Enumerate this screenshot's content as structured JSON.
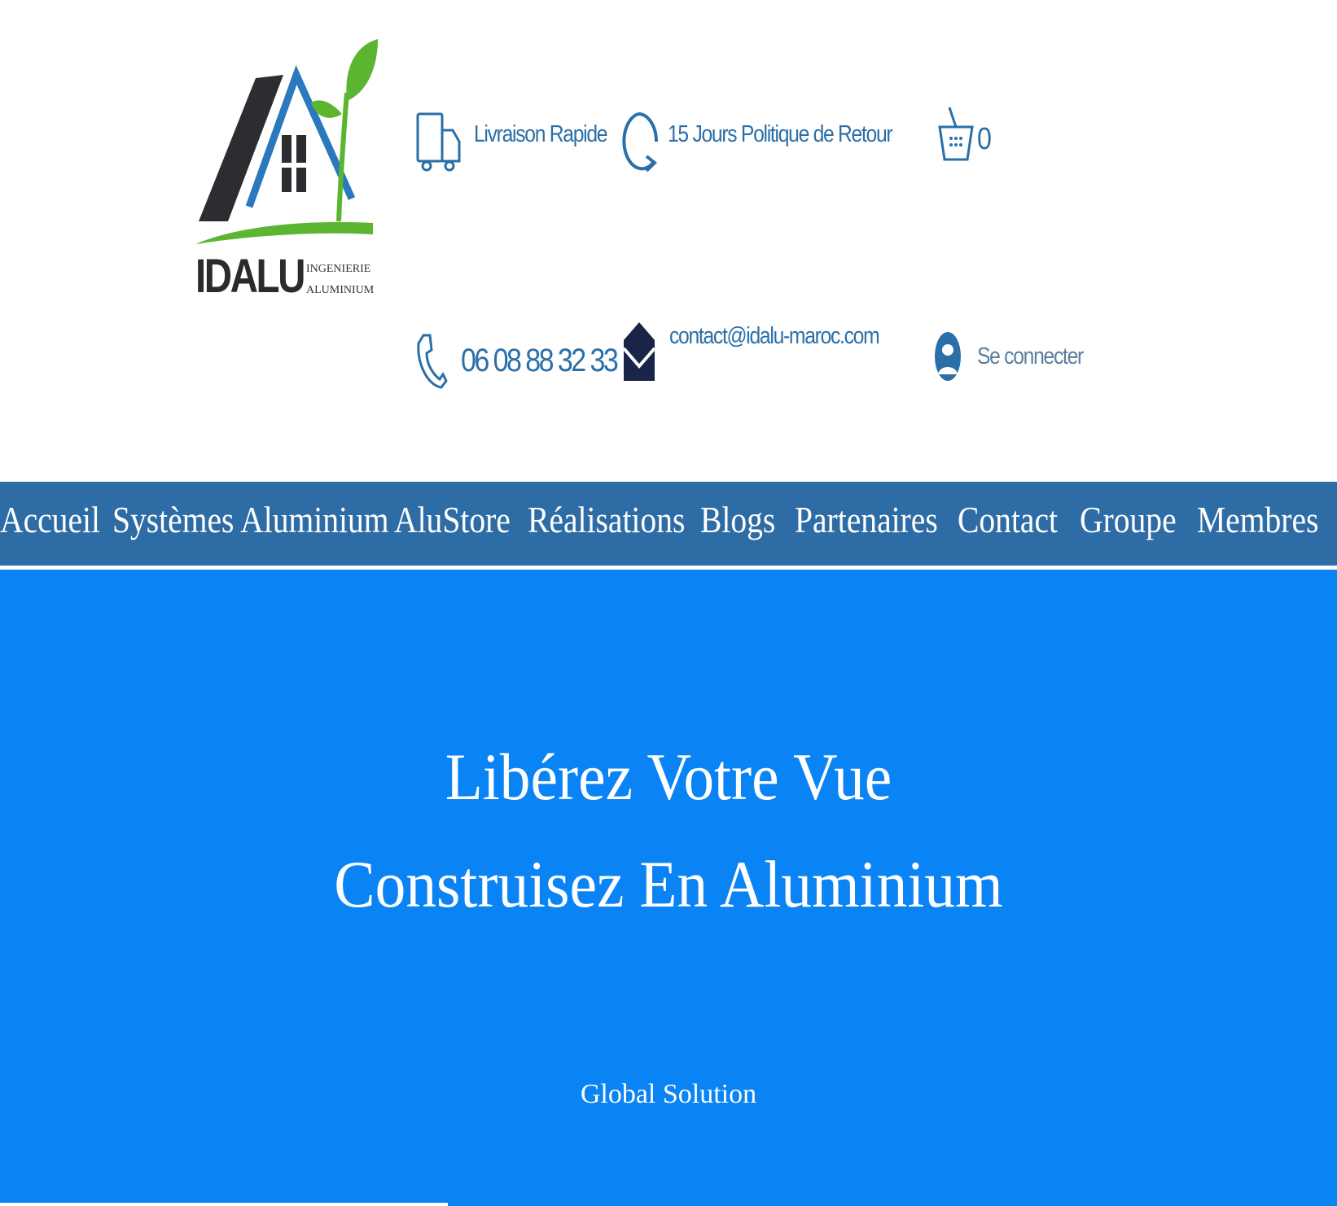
{
  "header": {
    "logo": {
      "name": "IDALU",
      "tagline_1": "INGENIERIE",
      "tagline_2": "ALUMINIUM"
    },
    "delivery": {
      "icon": "truck-icon",
      "label": "Livraison Rapide"
    },
    "returns": {
      "icon": "refresh-icon",
      "label": "15 Jours Politique de Retour"
    },
    "cart": {
      "icon": "basket-icon",
      "count": "0"
    },
    "phone": {
      "icon": "phone-icon",
      "label": "06 08 88 32 33"
    },
    "email": {
      "icon": "envelope-icon",
      "label": "contact@idalu-maroc.com"
    },
    "login": {
      "icon": "user-icon",
      "label": "Se connecter"
    }
  },
  "nav": {
    "items": [
      {
        "label": "Accueil"
      },
      {
        "label": "Systèmes Aluminium"
      },
      {
        "label": "AluStore"
      },
      {
        "label": "Réalisations"
      },
      {
        "label": "Blogs"
      },
      {
        "label": "Partenaires"
      },
      {
        "label": "Contact"
      },
      {
        "label": "Groupe"
      },
      {
        "label": "Membres"
      }
    ]
  },
  "hero": {
    "line_1": "Libérez Votre Vue",
    "line_2": "Construisez En Aluminium",
    "subtitle": "Global Solution"
  },
  "colors": {
    "brand_blue": "#2a6fa8",
    "nav_bg": "#2e6ca5",
    "hero_bg": "#0a84f5",
    "logo_green": "#5cb531",
    "logo_dark": "#2b2b2b"
  }
}
